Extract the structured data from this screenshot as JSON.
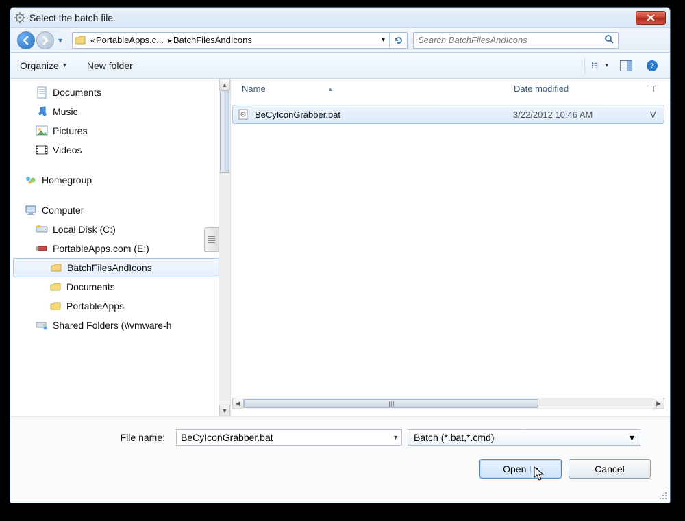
{
  "title": "Select the batch file.",
  "breadcrumb": {
    "prefix_chev": "«",
    "items": [
      "PortableApps.c...",
      "BatchFilesAndIcons"
    ]
  },
  "search": {
    "placeholder": "Search BatchFilesAndIcons"
  },
  "toolbar": {
    "organize": "Organize",
    "newfolder": "New folder"
  },
  "tree": {
    "items": [
      {
        "indent": 36,
        "icon": "doc",
        "label": "Documents"
      },
      {
        "indent": 36,
        "icon": "music",
        "label": "Music"
      },
      {
        "indent": 36,
        "icon": "pic",
        "label": "Pictures"
      },
      {
        "indent": 36,
        "icon": "video",
        "label": "Videos"
      },
      {
        "indent": 0,
        "icon": "",
        "label": "",
        "spacer": true
      },
      {
        "indent": 20,
        "icon": "homegroup",
        "label": "Homegroup"
      },
      {
        "indent": 0,
        "icon": "",
        "label": "",
        "spacer": true
      },
      {
        "indent": 20,
        "icon": "computer",
        "label": "Computer"
      },
      {
        "indent": 36,
        "icon": "disk",
        "label": "Local Disk (C:)"
      },
      {
        "indent": 36,
        "icon": "usb",
        "label": "PortableApps.com (E:)"
      },
      {
        "indent": 56,
        "icon": "folder",
        "label": "BatchFilesAndIcons",
        "selected": true
      },
      {
        "indent": 56,
        "icon": "folder",
        "label": "Documents"
      },
      {
        "indent": 56,
        "icon": "folder",
        "label": "PortableApps"
      },
      {
        "indent": 36,
        "icon": "netdrive",
        "label": "Shared Folders (\\\\vmware-h"
      }
    ]
  },
  "filelist": {
    "columns": {
      "name": "Name",
      "date": "Date modified",
      "type": "T"
    },
    "rows": [
      {
        "name": "BeCyIconGrabber.bat",
        "date": "3/22/2012 10:46 AM",
        "type": "V",
        "selected": true
      }
    ]
  },
  "bottom": {
    "filename_label": "File name:",
    "filename_value": "BeCyIconGrabber.bat",
    "filter": "Batch (*.bat,*.cmd)",
    "open": "Open",
    "cancel": "Cancel"
  }
}
